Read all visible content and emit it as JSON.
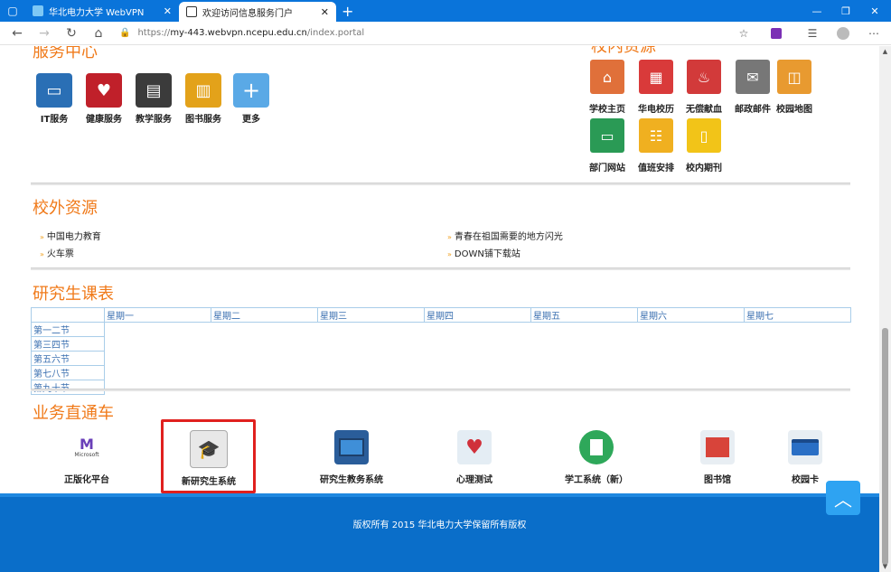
{
  "browser": {
    "tabs": [
      {
        "title": "华北电力大学 WebVPN"
      },
      {
        "title": "欢迎访问信息服务门户"
      }
    ],
    "url_prefix": "https://",
    "url_host": "my-443.webvpn.ncepu.edu.cn",
    "url_path": "/index.portal"
  },
  "service_center": {
    "title": "服务中心",
    "items": [
      {
        "label": "IT服务",
        "icon": "monitor-icon",
        "color": "#2a6fb5"
      },
      {
        "label": "健康服务",
        "icon": "stethoscope-icon",
        "color": "#c0202a"
      },
      {
        "label": "教学服务",
        "icon": "blackboard-icon",
        "color": "#3b3b3b"
      },
      {
        "label": "图书服务",
        "icon": "books-icon",
        "color": "#e3a21a"
      },
      {
        "label": "更多",
        "icon": "plus-icon",
        "color": "#5aa9e6"
      }
    ]
  },
  "campus_resources": {
    "title": "校内资源",
    "items": [
      {
        "label": "学校主页",
        "icon": "school-icon",
        "color": "#e0703a"
      },
      {
        "label": "华电校历",
        "icon": "calendar-icon",
        "color": "#d93a3a"
      },
      {
        "label": "无偿献血",
        "icon": "blood-drop-icon",
        "color": "#d23a3a"
      },
      {
        "label": "邮政邮件",
        "icon": "stamp-icon",
        "color": "#777777"
      },
      {
        "label": "校园地图",
        "icon": "map-icon",
        "color": "#e89a30"
      },
      {
        "label": "部门网站",
        "icon": "monitor-icon",
        "color": "#2a9a55"
      },
      {
        "label": "值班安排",
        "icon": "schedule-icon",
        "color": "#f0b020"
      },
      {
        "label": "校内期刊",
        "icon": "journal-icon",
        "color": "#f2c418"
      }
    ]
  },
  "external_resources": {
    "title": "校外资源",
    "links": [
      "中国电力教育",
      "火车票",
      "青春在祖国需要的地方闪光",
      "DOWN铺下载站"
    ]
  },
  "course_table": {
    "title": "研究生课表",
    "days": [
      "星期一",
      "星期二",
      "星期三",
      "星期四",
      "星期五",
      "星期六",
      "星期七"
    ],
    "periods": [
      "第一二节",
      "第三四节",
      "第五六节",
      "第七八节",
      "第九十节"
    ]
  },
  "business": {
    "title": "业务直通车",
    "items": [
      {
        "label": "正版化平台",
        "icon": "microsoft-logo-icon"
      },
      {
        "label": "新研究生系统",
        "icon": "graduation-cap-icon"
      },
      {
        "label": "研究生教务系统",
        "icon": "monitor-icon"
      },
      {
        "label": "心理测试",
        "icon": "heartbeat-icon"
      },
      {
        "label": "学工系统（新）",
        "icon": "document-icon"
      },
      {
        "label": "图书馆",
        "icon": "library-building-icon"
      },
      {
        "label": "校园卡",
        "icon": "card-icon"
      }
    ],
    "microsoft_text": "Microsoft"
  },
  "footer": {
    "copyright": "版权所有 2015 华北电力大学保留所有版权"
  }
}
